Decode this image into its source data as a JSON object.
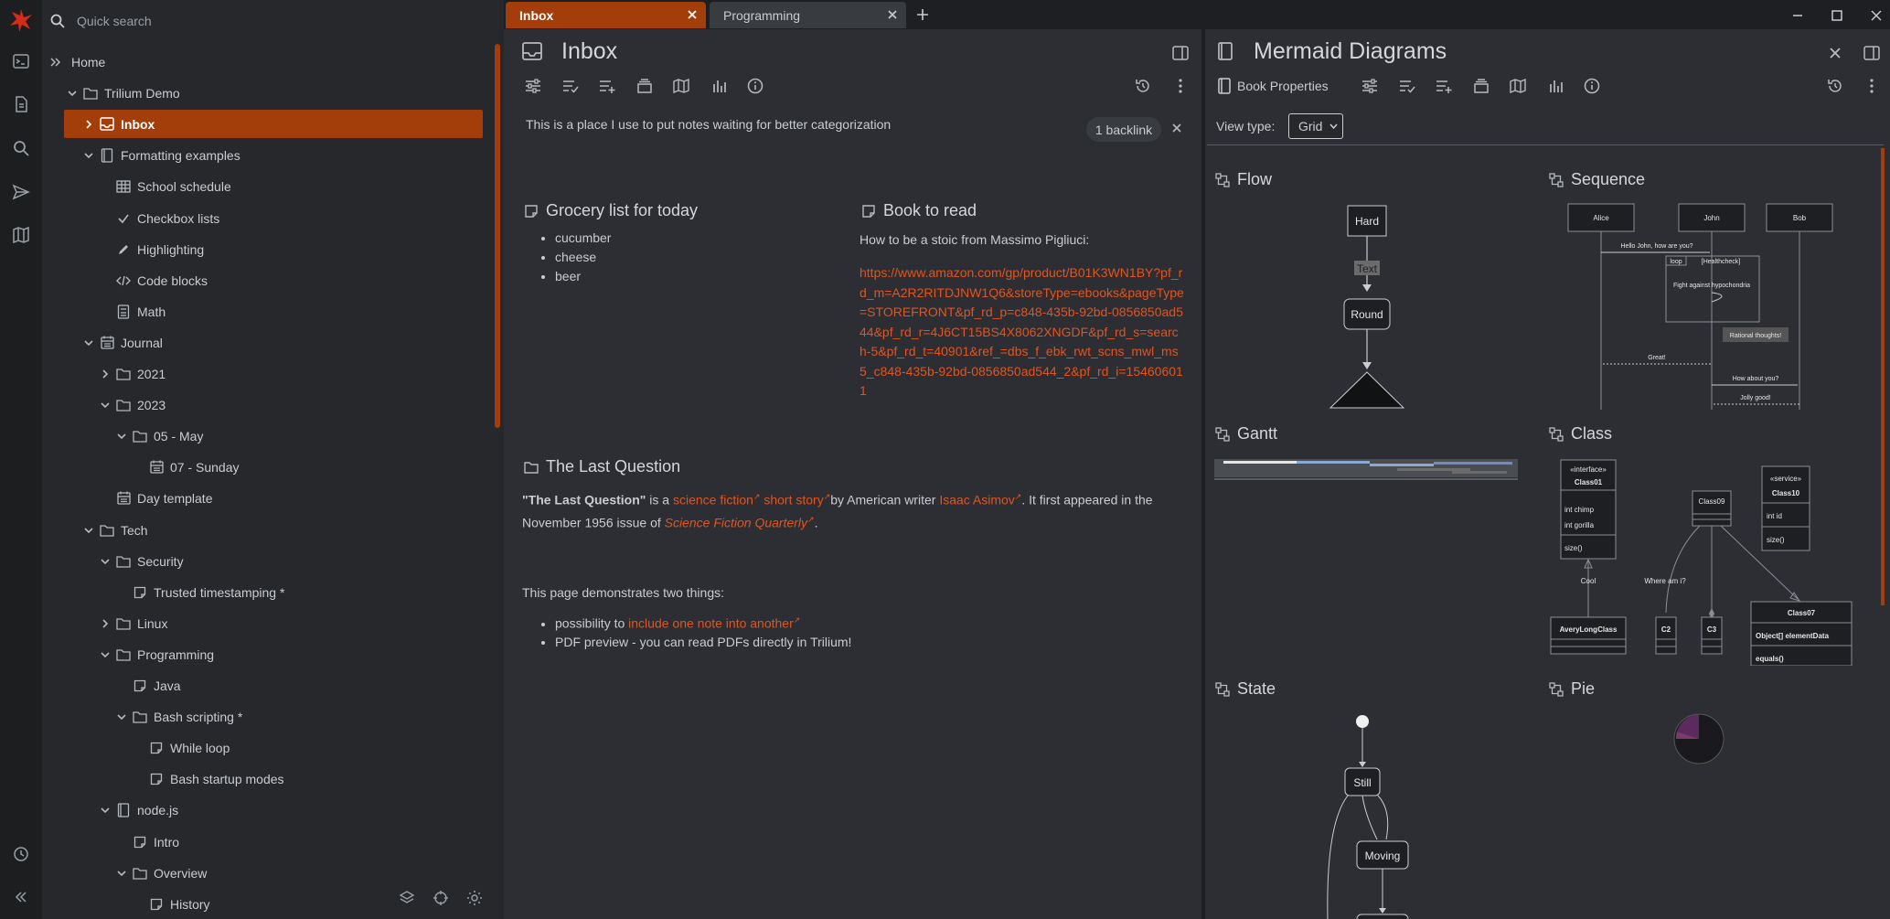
{
  "colors": {
    "accent": "#a33d09",
    "link": "#e2541f",
    "pane_bg": "#2c2e33",
    "tree_bg": "#26282b"
  },
  "search": {
    "placeholder": "Quick search"
  },
  "tree": {
    "rows": [
      {
        "label": "Home",
        "icon": "double-chevron-icon",
        "level": 0
      },
      {
        "label": "Trilium Demo",
        "icon": "folder-icon",
        "level": 1,
        "expanded": true
      },
      {
        "label": "Inbox",
        "icon": "inbox-icon",
        "level": 2,
        "active": true,
        "expanded": false
      },
      {
        "label": "Formatting examples",
        "icon": "book-icon",
        "level": 2,
        "expanded": true
      },
      {
        "label": "School schedule",
        "icon": "table-icon",
        "level": 3
      },
      {
        "label": "Checkbox lists",
        "icon": "check-icon",
        "level": 3
      },
      {
        "label": "Highlighting",
        "icon": "pencil-icon",
        "level": 3
      },
      {
        "label": "Code blocks",
        "icon": "code-icon",
        "level": 3
      },
      {
        "label": "Math",
        "icon": "calculator-icon",
        "level": 3
      },
      {
        "label": "Journal",
        "icon": "calendar-icon",
        "level": 2,
        "expanded": true
      },
      {
        "label": "2021",
        "icon": "folder-icon",
        "level": 3,
        "expanded": false
      },
      {
        "label": "2023",
        "icon": "folder-icon",
        "level": 3,
        "expanded": true
      },
      {
        "label": "05 - May",
        "icon": "folder-icon",
        "level": 4,
        "expanded": true
      },
      {
        "label": "07 - Sunday",
        "icon": "calendar-icon",
        "level": 5
      },
      {
        "label": "Day template",
        "icon": "calendar-icon",
        "level": 3
      },
      {
        "label": "Tech",
        "icon": "folder-icon",
        "level": 2,
        "expanded": true
      },
      {
        "label": "Security",
        "icon": "folder-icon",
        "level": 3,
        "expanded": true
      },
      {
        "label": "Trusted timestamping *",
        "icon": "note-icon",
        "level": 4
      },
      {
        "label": "Linux",
        "icon": "folder-icon",
        "level": 3,
        "expanded": false
      },
      {
        "label": "Programming",
        "icon": "folder-icon",
        "level": 3,
        "expanded": true
      },
      {
        "label": "Java",
        "icon": "note-icon",
        "level": 4
      },
      {
        "label": "Bash scripting *",
        "icon": "folder-icon",
        "level": 4,
        "expanded": true
      },
      {
        "label": "While loop",
        "icon": "note-icon",
        "level": 5
      },
      {
        "label": "Bash startup modes",
        "icon": "note-icon",
        "level": 5
      },
      {
        "label": "node.js",
        "icon": "book-icon",
        "level": 3,
        "expanded": true
      },
      {
        "label": "Intro",
        "icon": "note-icon",
        "level": 4
      },
      {
        "label": "Overview",
        "icon": "folder-icon",
        "level": 4,
        "expanded": true
      },
      {
        "label": "History",
        "icon": "note-icon",
        "level": 5
      }
    ]
  },
  "tabs": [
    {
      "label": "Inbox",
      "active": true
    },
    {
      "label": "Programming",
      "active": false
    }
  ],
  "inbox": {
    "title": "Inbox",
    "description": "This is a place I use to put notes waiting for better categorization",
    "backlinks": "1 backlink",
    "grocery": {
      "title": "Grocery list for today",
      "items": [
        "cucumber",
        "cheese",
        "beer"
      ]
    },
    "book": {
      "title": "Book to read",
      "line": "How to be a stoic from Massimo Pigliuci:",
      "url": "https://www.amazon.com/gp/product/B01K3WN1BY?pf_rd_m=A2R2RITDJNW1Q6&storeType=ebooks&pageType=STOREFRONT&pf_rd_p=c848-435b-92bd-0856850ad544&pf_rd_r=4J6CT15BS4X8062XNGDF&pf_rd_s=search-5&pf_rd_t=40901&ref_=dbs_f_ebk_rwt_scns_mwl_ms5_c848-435b-92bd-0856850ad544_2&pf_rd_i=154606011"
    },
    "last_question": {
      "title": "The Last Question",
      "bold": "\"The Last Question\"",
      "is_a": " is a ",
      "link1": "science fiction",
      "link2": "short story",
      "by": "by American writer ",
      "link3": "Isaac Asimov",
      "appeared": ". It first appeared in the",
      "issue": "November 1956 issue of ",
      "link4": "Science Fiction Quarterly",
      "end": "."
    },
    "demo": {
      "intro": "This page demonstrates two things:",
      "b1_prefix": "possibility to ",
      "b1_link": "include one note into another",
      "b2": "PDF preview - you can read PDFs directly in Trilium!"
    }
  },
  "mermaid": {
    "title": "Mermaid Diagrams",
    "book_properties": "Book Properties",
    "view_type_label": "View type:",
    "view_type_value": "Grid",
    "cards": [
      {
        "key": "flow",
        "title": "Flow"
      },
      {
        "key": "sequence",
        "title": "Sequence"
      },
      {
        "key": "gantt",
        "title": "Gantt"
      },
      {
        "key": "class",
        "title": "Class"
      },
      {
        "key": "state",
        "title": "State"
      },
      {
        "key": "pie",
        "title": "Pie"
      }
    ],
    "flow": {
      "n1": "Hard",
      "edge": "Text",
      "n2": "Round"
    },
    "sequence": {
      "actors": [
        "Alice",
        "John",
        "Bob"
      ],
      "m1": "Hello John, how are you?",
      "loop": "loop",
      "loop_cond": "[Healthcheck]",
      "self_msg": "Fight against hypochondria",
      "note": "Rational thoughts!",
      "m2": "Great!",
      "m3": "How about you?",
      "m4": "Jolly good!"
    },
    "class": {
      "c01_stereo": "«interface»",
      "c01": "Class01",
      "c01_f1": "int chimp",
      "c01_f2": "int gorilla",
      "c01_m1": "size()",
      "c09": "Class09",
      "c10_stereo": "«service»",
      "c10": "Class10",
      "c10_f1": "int id",
      "c10_m1": "size()",
      "cool": "Cool",
      "where": "Where am i?",
      "avery": "AveryLongClass",
      "c2": "C2",
      "c3": "C3",
      "c07": "Class07",
      "c07_f1": "Object[] elementData",
      "c07_m1": "equals()"
    },
    "state": {
      "s1": "Still",
      "s2": "Moving"
    }
  }
}
